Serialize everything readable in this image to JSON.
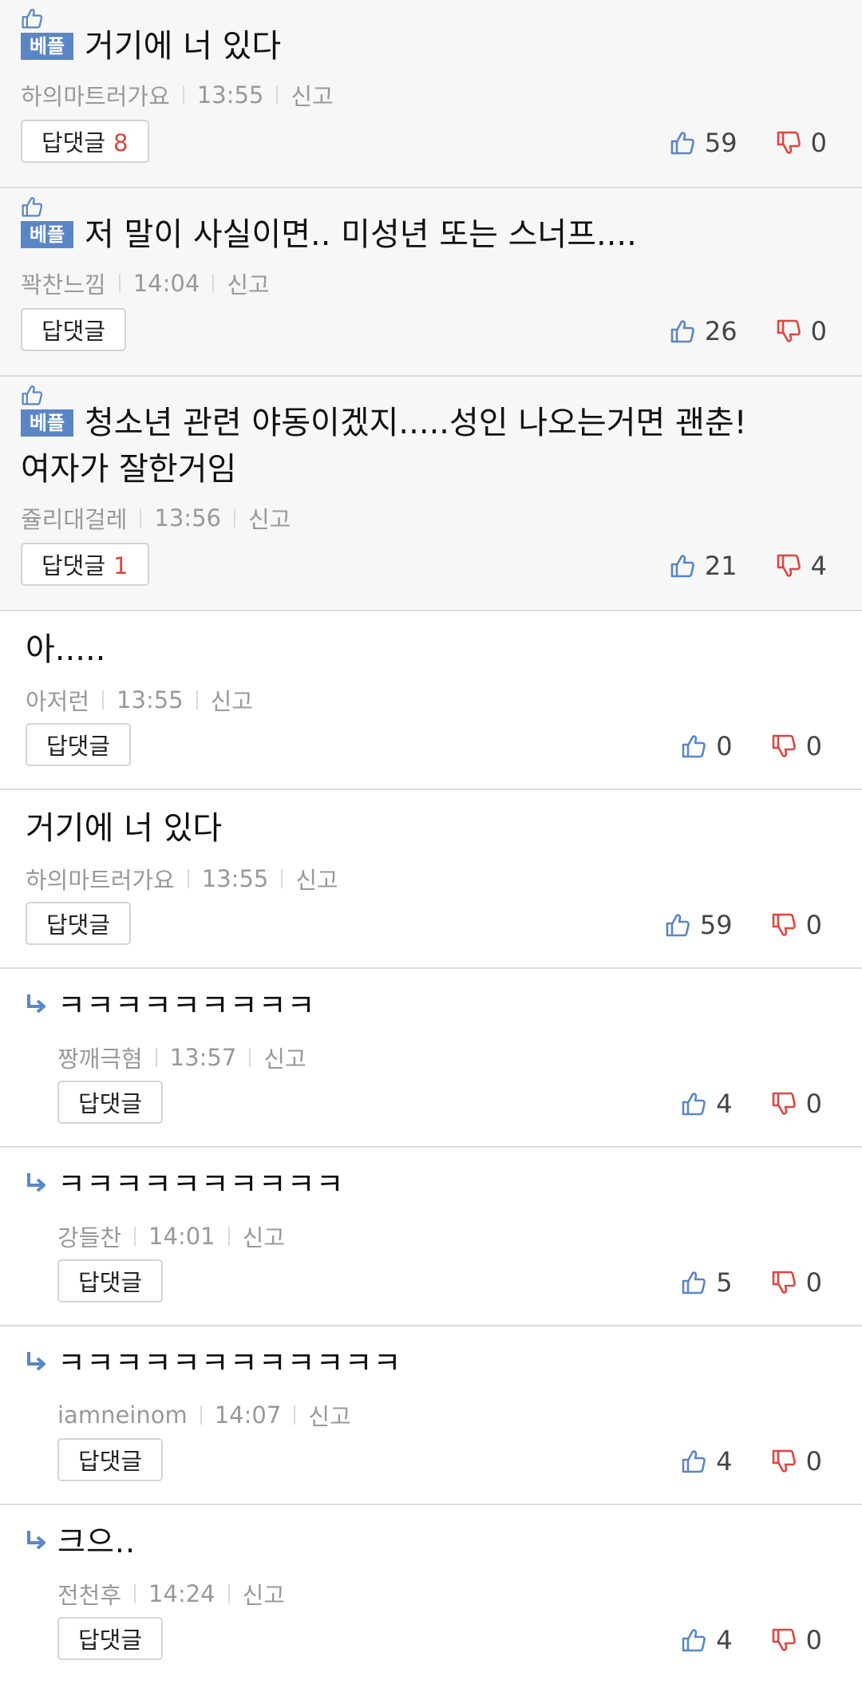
{
  "colors": {
    "accent_blue": "#5a86c6",
    "down_red": "#e0453f",
    "meta_gray": "#999999"
  },
  "best_label": "베플",
  "report_label": "신고",
  "reply_label": "답댓글",
  "comments": [
    {
      "type": "best",
      "text": "거기에 너 있다",
      "author": "하의마트러가요",
      "time": "13:55",
      "reply_count": "8",
      "up": "59",
      "down": "0"
    },
    {
      "type": "best",
      "text": "저 말이 사실이면.. 미성년 또는 스너프....",
      "author": "꽉찬느낌",
      "time": "14:04",
      "reply_count": "",
      "up": "26",
      "down": "0"
    },
    {
      "type": "best",
      "text": "청소년 관련 야동이겠지.....성인 나오는거면 괜춘!",
      "text_line2": "여자가 잘한거임",
      "author": "쥴리대걸레",
      "time": "13:56",
      "reply_count": "1",
      "up": "21",
      "down": "4"
    },
    {
      "type": "normal",
      "text": "아.....",
      "author": "아저런",
      "time": "13:55",
      "up": "0",
      "down": "0"
    },
    {
      "type": "normal",
      "text": "거기에 너 있다",
      "author": "하의마트러가요",
      "time": "13:55",
      "up": "59",
      "down": "0"
    },
    {
      "type": "reply",
      "text": "ㅋㅋㅋㅋㅋㅋㅋㅋㅋ",
      "author": "짱깨극혐",
      "time": "13:57",
      "up": "4",
      "down": "0"
    },
    {
      "type": "reply",
      "text": "ㅋㅋㅋㅋㅋㅋㅋㅋㅋㅋ",
      "author": "강들찬",
      "time": "14:01",
      "up": "5",
      "down": "0"
    },
    {
      "type": "reply",
      "text": "ㅋㅋㅋㅋㅋㅋㅋㅋㅋㅋㅋㅋ",
      "author": "iamneinom",
      "time": "14:07",
      "up": "4",
      "down": "0"
    },
    {
      "type": "reply",
      "text": "크으..",
      "author": "전천후",
      "time": "14:24",
      "up": "4",
      "down": "0"
    }
  ]
}
